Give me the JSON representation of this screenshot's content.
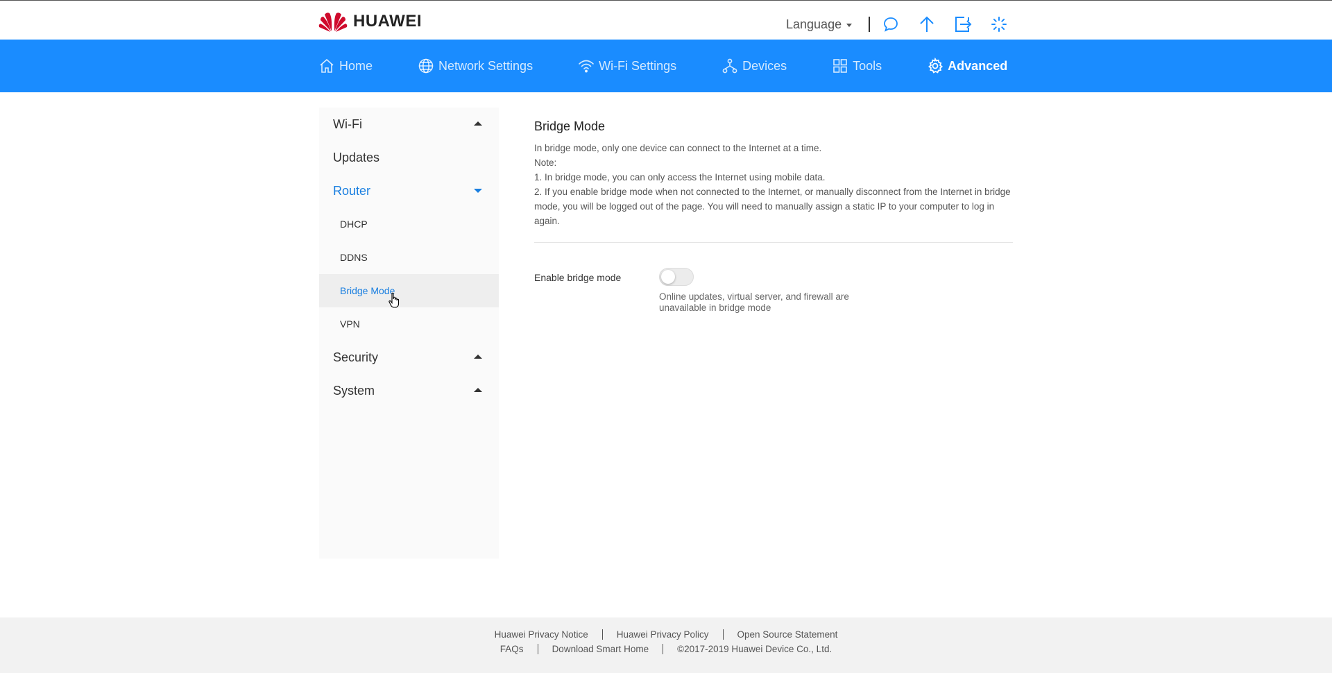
{
  "header": {
    "brand": "HUAWEI",
    "language_label": "Language",
    "icons": [
      "message-icon",
      "upload-arrow-icon",
      "logout-icon",
      "loading-spinner-icon"
    ]
  },
  "nav": {
    "items": [
      {
        "label": "Home",
        "icon": "home-icon"
      },
      {
        "label": "Network Settings",
        "icon": "globe-icon"
      },
      {
        "label": "Wi-Fi Settings",
        "icon": "wifi-icon"
      },
      {
        "label": "Devices",
        "icon": "devices-icon"
      },
      {
        "label": "Tools",
        "icon": "tools-icon"
      },
      {
        "label": "Advanced",
        "icon": "gear-icon",
        "active": true
      }
    ]
  },
  "sidebar": {
    "groups": [
      {
        "label": "Wi-Fi",
        "expanded": false
      },
      {
        "label": "Updates"
      },
      {
        "label": "Router",
        "expanded": true,
        "items": [
          {
            "label": "DHCP"
          },
          {
            "label": "DDNS"
          },
          {
            "label": "Bridge Mode",
            "selected": true
          },
          {
            "label": "VPN"
          }
        ]
      },
      {
        "label": "Security",
        "expanded": false
      },
      {
        "label": "System",
        "expanded": false
      }
    ]
  },
  "content": {
    "title": "Bridge Mode",
    "description": [
      "In bridge mode, only one device can connect to the Internet at a time.",
      "Note:",
      "1. In bridge mode, you can only access the Internet using mobile data.",
      "2. If you enable bridge mode when not connected to the Internet, or manually disconnect from the Internet in bridge mode, you will be logged out of the page. You will need to manually assign a static IP to your computer to log in again."
    ],
    "setting": {
      "label": "Enable bridge mode",
      "enabled": false,
      "hint": "Online updates, virtual server, and firewall are unavailable in bridge mode"
    }
  },
  "footer": {
    "row1": [
      "Huawei Privacy Notice",
      "Huawei Privacy Policy",
      "Open Source Statement"
    ],
    "row2": [
      "FAQs",
      "Download Smart Home",
      "©2017-2019 Huawei Device Co., Ltd."
    ]
  },
  "colors": {
    "accent": "#1a8cff",
    "link_active": "#1a7fe0",
    "brand_red": "#cf0a2c"
  }
}
